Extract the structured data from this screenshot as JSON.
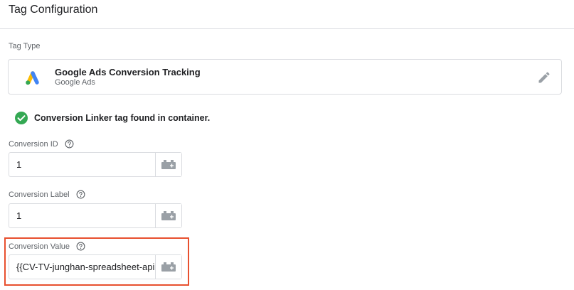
{
  "header": {
    "title": "Tag Configuration"
  },
  "tag_type": {
    "section_label": "Tag Type",
    "name": "Google Ads Conversion Tracking",
    "provider": "Google Ads",
    "icon": "google-ads-logo",
    "edit_icon": "pencil-icon"
  },
  "status": {
    "icon": "check-circle-icon",
    "message": "Conversion Linker tag found in container.",
    "color": "#34a853"
  },
  "fields": [
    {
      "label": "Conversion ID",
      "value": "1",
      "help_icon": "help-circle-icon",
      "variable_icon": "variable-picker-icon"
    },
    {
      "label": "Conversion Label",
      "value": "1",
      "help_icon": "help-circle-icon",
      "variable_icon": "variable-picker-icon"
    },
    {
      "label": "Conversion Value",
      "value": "{{CV-TV-junghan-spreadsheet-api",
      "help_icon": "help-circle-icon",
      "variable_icon": "variable-picker-icon",
      "highlighted": true
    }
  ],
  "colors": {
    "highlight": "#e8502f",
    "border": "#dadce0",
    "muted_text": "#5f6368",
    "ads_blue": "#4285f4",
    "ads_yellow": "#fbbc04",
    "ads_green": "#34a853"
  }
}
